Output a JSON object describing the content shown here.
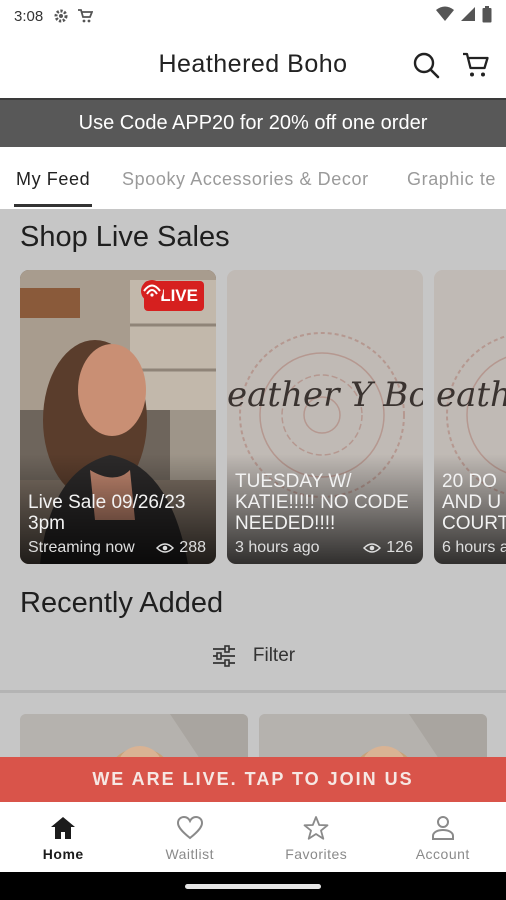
{
  "status_bar": {
    "time": "3:08"
  },
  "header": {
    "title": "Heathered Boho"
  },
  "promo": {
    "text": "Use Code APP20 for 20% off one order"
  },
  "tabs": [
    {
      "label": "My Feed"
    },
    {
      "label": "Spooky Accessories & Decor"
    },
    {
      "label": "Graphic te"
    }
  ],
  "live_sales": {
    "title": "Shop Live Sales",
    "badge": "LIVE",
    "cards": [
      {
        "title": "Live Sale 09/26/23 3pm",
        "status": "Streaming now",
        "views": "288"
      },
      {
        "title": "TUESDAY W/ KATIE!!!!! NO CODE NEEDED!!!!",
        "status": "3 hours ago",
        "views": "126"
      },
      {
        "title": "20 DO AND U COURT",
        "status": "6 hours a",
        "views": ""
      }
    ],
    "card_logo_text": "eather Y Bo"
  },
  "recently_added": {
    "title": "Recently Added",
    "filter_label": "Filter"
  },
  "join_bar": {
    "text": "WE ARE LIVE. TAP TO JOIN US"
  },
  "bottom_nav": [
    {
      "label": "Home",
      "icon": "home-icon"
    },
    {
      "label": "Waitlist",
      "icon": "heart-icon"
    },
    {
      "label": "Favorites",
      "icon": "star-icon"
    },
    {
      "label": "Account",
      "icon": "person-icon"
    }
  ],
  "colors": {
    "promo_bg": "#585858",
    "live_red": "#d6201f",
    "join_bar": "#d9544a"
  }
}
